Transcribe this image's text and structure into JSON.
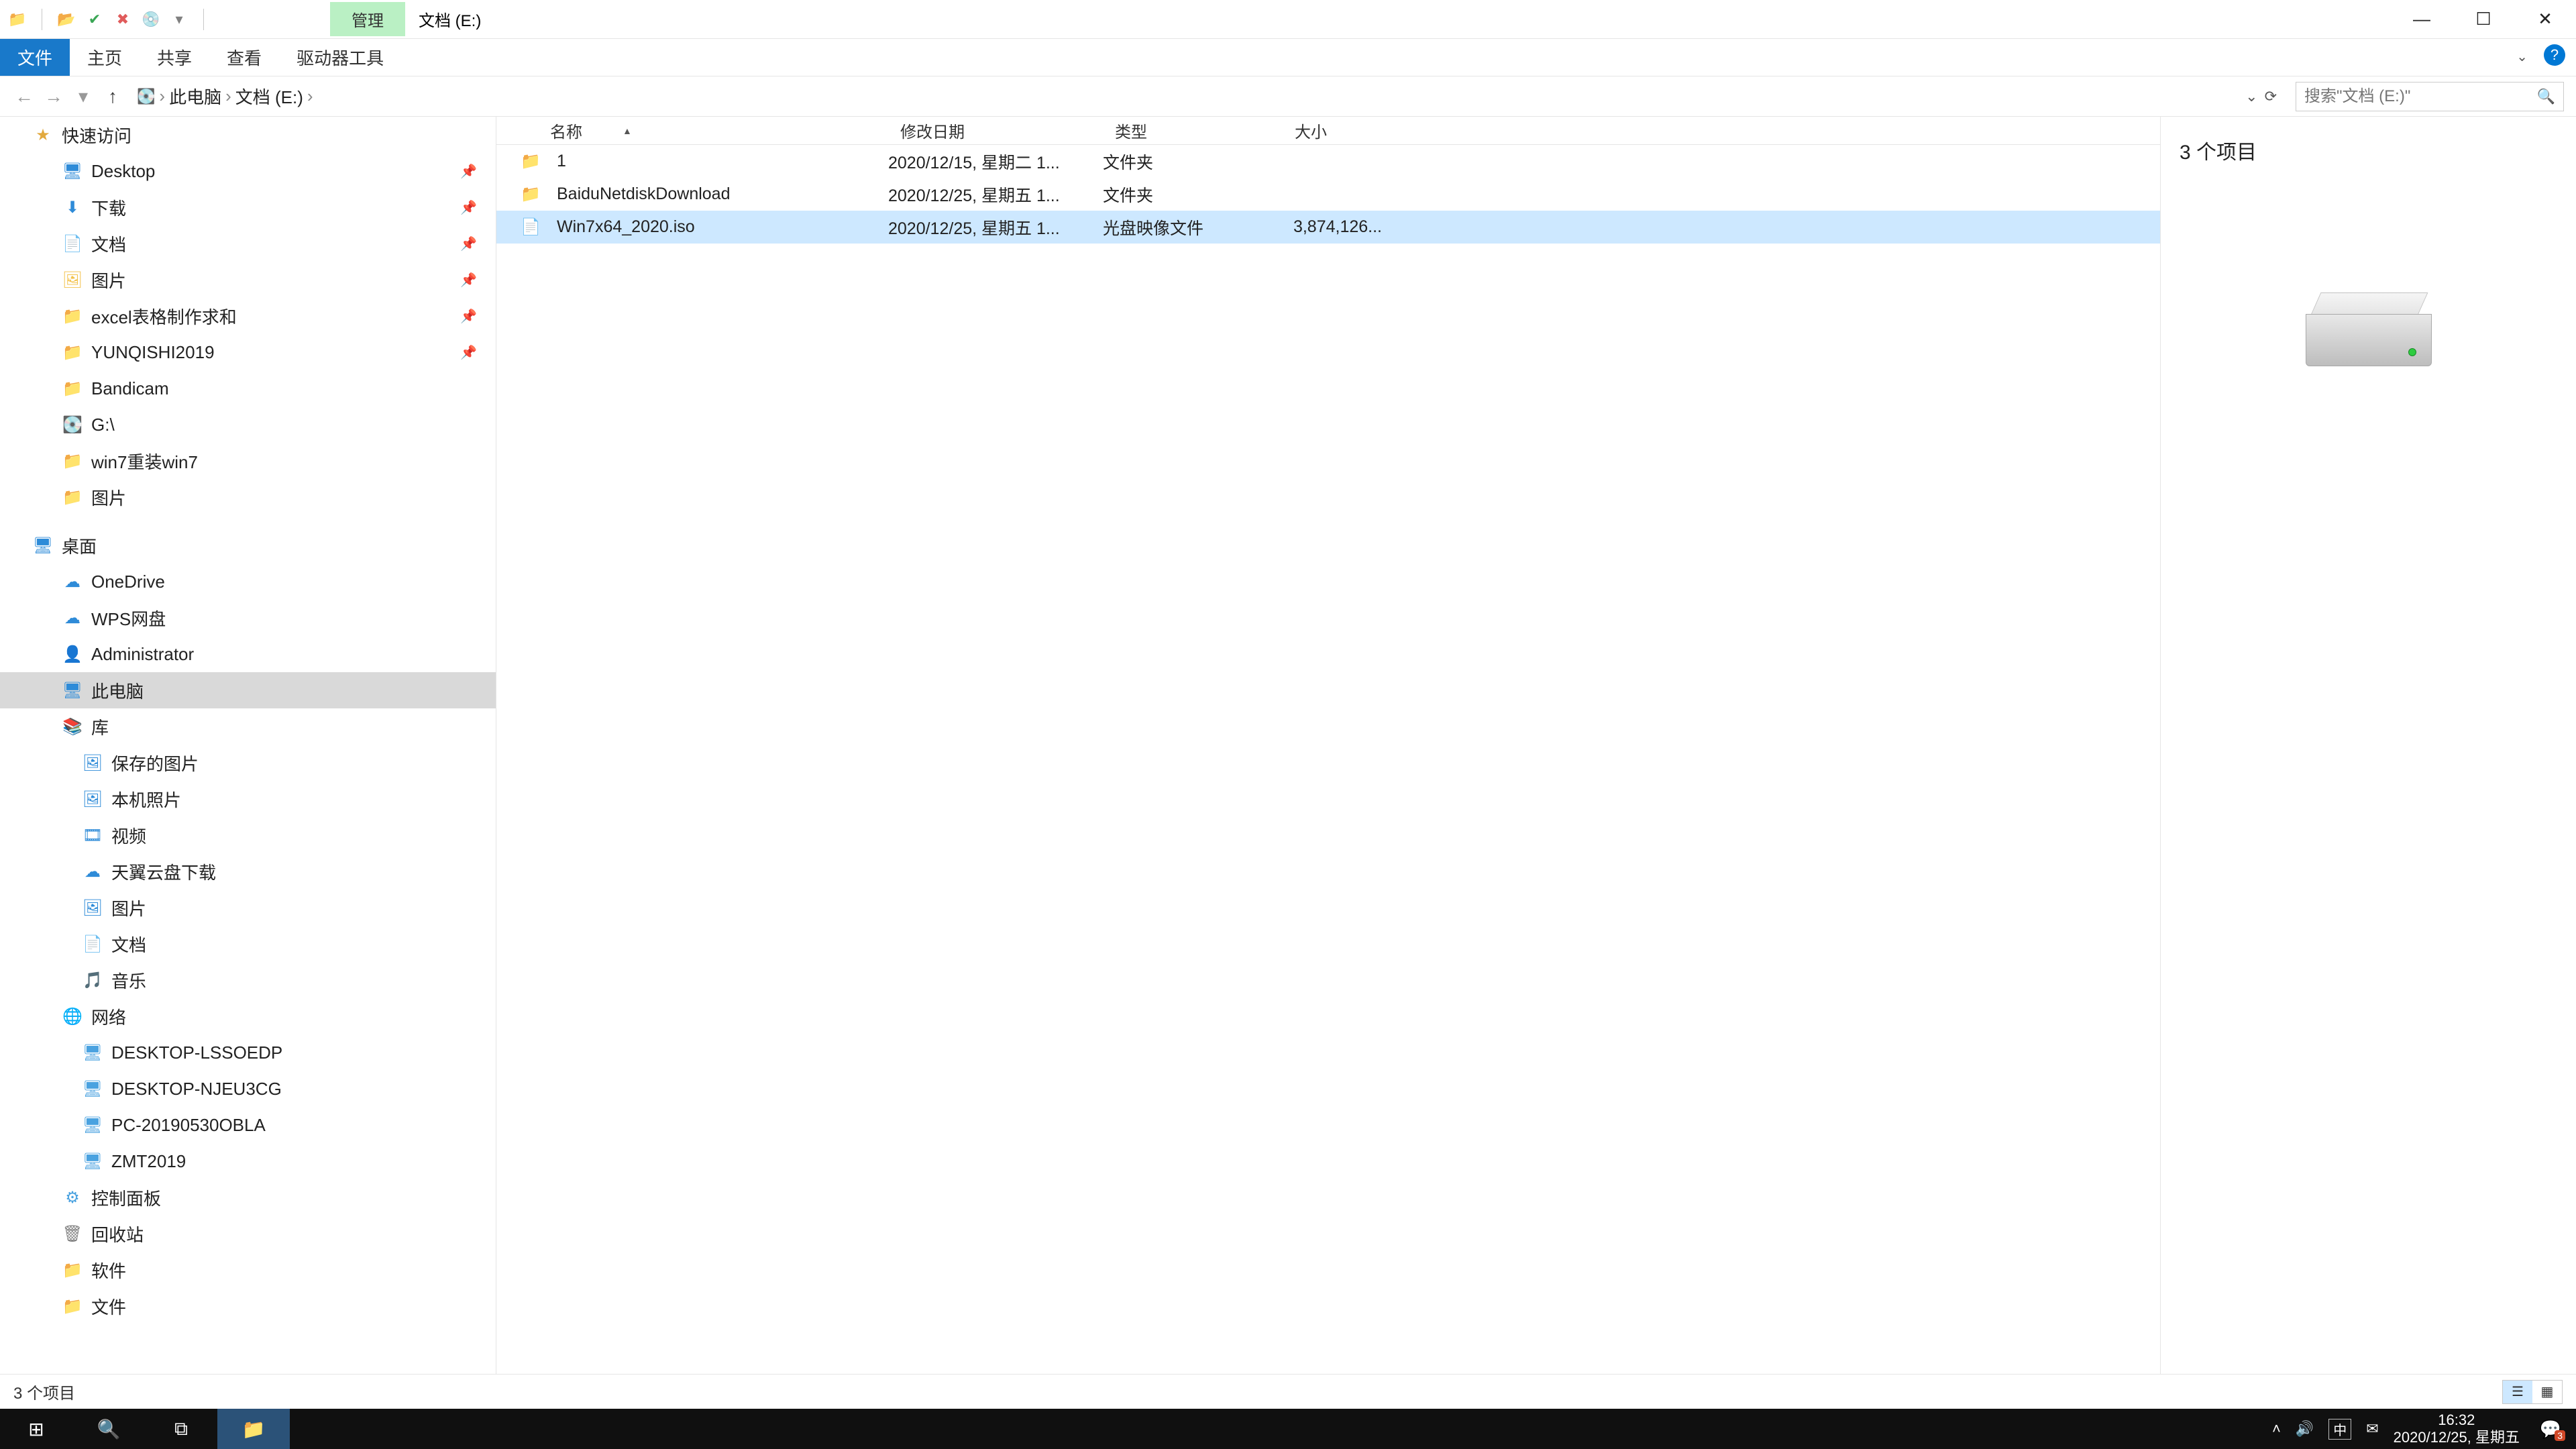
{
  "titlebar": {
    "contextual_tab": "管理",
    "window_title": "文档 (E:)"
  },
  "ribbon": {
    "tabs": {
      "file": "文件",
      "home": "主页",
      "share": "共享",
      "view": "查看",
      "drive_tools": "驱动器工具"
    }
  },
  "breadcrumb": {
    "this_pc": "此电脑",
    "drive": "文档 (E:)"
  },
  "search": {
    "placeholder": "搜索\"文档 (E:)\""
  },
  "navpane": {
    "quick_access": "快速访问",
    "items_qa": [
      {
        "label": "Desktop",
        "icon": "🖥",
        "cls": "c-blue",
        "pin": true
      },
      {
        "label": "下载",
        "icon": "⬇",
        "cls": "c-blue",
        "pin": true
      },
      {
        "label": "文档",
        "icon": "📄",
        "cls": "c-folder",
        "pin": true
      },
      {
        "label": "图片",
        "icon": "🖼",
        "cls": "c-folder",
        "pin": true
      },
      {
        "label": "excel表格制作求和",
        "icon": "📁",
        "cls": "c-folder",
        "pin": true
      },
      {
        "label": "YUNQISHI2019",
        "icon": "📁",
        "cls": "c-folder",
        "pin": true
      },
      {
        "label": "Bandicam",
        "icon": "📁",
        "cls": "c-folder",
        "pin": false
      },
      {
        "label": "G:\\",
        "icon": "💽",
        "cls": "c-blue",
        "pin": false
      },
      {
        "label": "win7重装win7",
        "icon": "📁",
        "cls": "c-folder",
        "pin": false
      },
      {
        "label": "图片",
        "icon": "📁",
        "cls": "c-folder",
        "pin": false
      }
    ],
    "desktop": "桌面",
    "items_desktop": [
      {
        "label": "OneDrive",
        "icon": "☁",
        "cls": "c-blue"
      },
      {
        "label": "WPS网盘",
        "icon": "☁",
        "cls": "c-blue"
      },
      {
        "label": "Administrator",
        "icon": "👤",
        "cls": "c-green"
      },
      {
        "label": "此电脑",
        "icon": "🖥",
        "cls": "c-blue",
        "selected": true
      },
      {
        "label": "库",
        "icon": "📚",
        "cls": "c-lib"
      }
    ],
    "items_lib": [
      {
        "label": "保存的图片",
        "icon": "🖼",
        "cls": "c-blue"
      },
      {
        "label": "本机照片",
        "icon": "🖼",
        "cls": "c-blue"
      },
      {
        "label": "视频",
        "icon": "🎞",
        "cls": "c-blue"
      },
      {
        "label": "天翼云盘下载",
        "icon": "☁",
        "cls": "c-blue"
      },
      {
        "label": "图片",
        "icon": "🖼",
        "cls": "c-blue"
      },
      {
        "label": "文档",
        "icon": "📄",
        "cls": "c-blue"
      },
      {
        "label": "音乐",
        "icon": "🎵",
        "cls": "c-blue"
      }
    ],
    "network": "网络",
    "items_net": [
      {
        "label": "DESKTOP-LSSOEDP",
        "icon": "🖥",
        "cls": "c-net"
      },
      {
        "label": "DESKTOP-NJEU3CG",
        "icon": "🖥",
        "cls": "c-net"
      },
      {
        "label": "PC-20190530OBLA",
        "icon": "🖥",
        "cls": "c-net"
      },
      {
        "label": "ZMT2019",
        "icon": "🖥",
        "cls": "c-net"
      }
    ],
    "control_panel": "控制面板",
    "recycle_bin": "回收站",
    "software": "软件",
    "docs": "文件"
  },
  "columns": {
    "name": "名称",
    "modified": "修改日期",
    "type": "类型",
    "size": "大小"
  },
  "files": [
    {
      "name": "1",
      "icon": "📁",
      "icon_cls": "c-folder",
      "date": "2020/12/15, 星期二 1...",
      "type": "文件夹",
      "size": ""
    },
    {
      "name": "BaiduNetdiskDownload",
      "icon": "📁",
      "icon_cls": "c-folder",
      "date": "2020/12/25, 星期五 1...",
      "type": "文件夹",
      "size": ""
    },
    {
      "name": "Win7x64_2020.iso",
      "icon": "📄",
      "icon_cls": "c-grey",
      "date": "2020/12/25, 星期五 1...",
      "type": "光盘映像文件",
      "size": "3,874,126...",
      "selected": true
    }
  ],
  "preview": {
    "count_text": "3 个项目"
  },
  "statusbar": {
    "item_count": "3 个项目"
  },
  "taskbar": {
    "time": "16:32",
    "date": "2020/12/25, 星期五",
    "ime": "中",
    "notif_count": "3"
  }
}
